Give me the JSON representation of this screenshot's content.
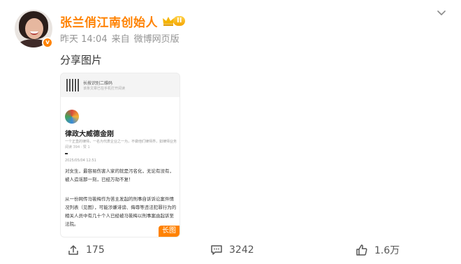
{
  "post": {
    "username": "张兰俏江南创始人",
    "level": "II",
    "verified_badge": "v",
    "time": "昨天 14:04",
    "source_prefix": "来自",
    "source": "微博网页版",
    "text": "分享图片"
  },
  "image": {
    "qr_title": "长按识别二维码",
    "qr_sub": "该条文章已在手机打开阅读",
    "author": "律政大威德金刚",
    "subtitle": "一个正直的律师，一名为代表企业之一为，不做他们律师界，如律师业务",
    "meta": "阅读 394  ·  赞 1",
    "date": "2025/05/04 12:51",
    "para1": "对女生，最容易伤害人家的就是污名化，无论有没有，被人造谣那一刻，已经万劫不复！",
    "para2": "从一份网传马筱梅作为苦主发起的刑事自诉诉讼案件情况列表（见图），可能涉嫌诽谤、侮辱等违法犯罪行为的相关人员中有几十个人已经被马筱梅以刑事案由起诉至法院。",
    "long_tag": "长图"
  },
  "actions": {
    "share_count": "175",
    "comment_count": "3242",
    "like_count": "1.6万"
  },
  "colors": {
    "brand": "#ff8200",
    "meta": "#939393"
  }
}
